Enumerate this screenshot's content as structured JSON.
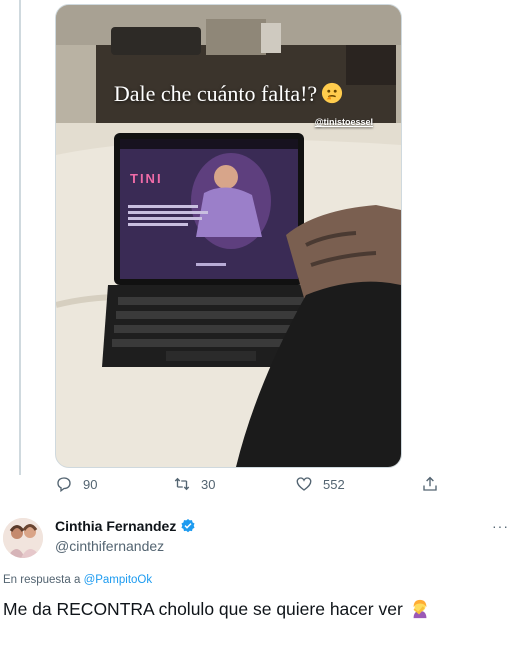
{
  "story": {
    "caption": "Dale che cuánto falta!?",
    "caption_emoji": "thinking-face-emoji",
    "tag": "@tinistoessel",
    "screen_title": "TINI"
  },
  "actions": {
    "replies": "90",
    "retweets": "30",
    "likes": "552"
  },
  "reply": {
    "name": "Cinthia Fernandez",
    "handle": "@cinthifernandez",
    "more": "···",
    "replying_prefix": "En respuesta a",
    "replying_to": "@PampitoOk",
    "text": "Me da RECONTRA cholulo que se quiere hacer ver",
    "text_emoji": "woman-facepalming-emoji"
  },
  "colors": {
    "accent": "#1d9bf0",
    "muted": "#536471",
    "text": "#0f1419",
    "divider": "#cfd9de"
  }
}
